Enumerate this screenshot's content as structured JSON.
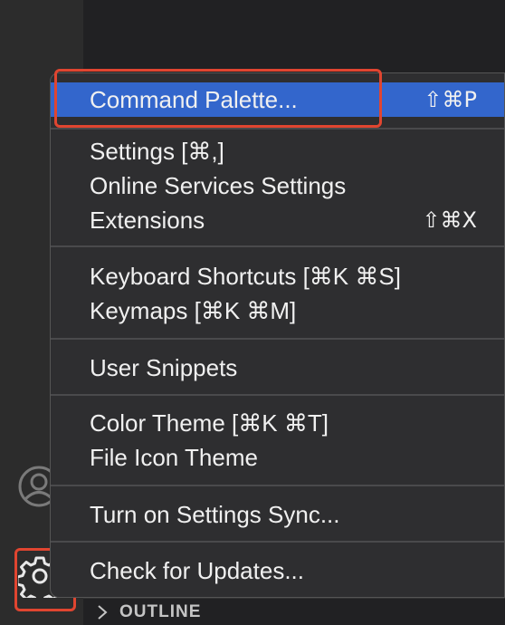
{
  "menu": {
    "groups": [
      [
        {
          "label": "Command Palette...",
          "shortcut": "⇧⌘P",
          "active": true
        }
      ],
      [
        {
          "label": "Settings [⌘,]",
          "shortcut": ""
        },
        {
          "label": "Online Services Settings",
          "shortcut": ""
        },
        {
          "label": "Extensions",
          "shortcut": "⇧⌘X"
        }
      ],
      [
        {
          "label": "Keyboard Shortcuts [⌘K ⌘S]",
          "shortcut": ""
        },
        {
          "label": "Keymaps [⌘K ⌘M]",
          "shortcut": ""
        }
      ],
      [
        {
          "label": "User Snippets",
          "shortcut": ""
        }
      ],
      [
        {
          "label": "Color Theme [⌘K ⌘T]",
          "shortcut": ""
        },
        {
          "label": "File Icon Theme",
          "shortcut": ""
        }
      ],
      [
        {
          "label": "Turn on Settings Sync...",
          "shortcut": ""
        }
      ],
      [
        {
          "label": "Check for Updates...",
          "shortcut": ""
        }
      ]
    ]
  },
  "outline": {
    "label": "OUTLINE"
  },
  "activity_bar": {
    "icons": [
      "accounts-icon",
      "gear-icon"
    ]
  },
  "colors": {
    "menu_bg": "#2e2e30",
    "active_item": "#3366cc",
    "highlight": "#e04530"
  }
}
